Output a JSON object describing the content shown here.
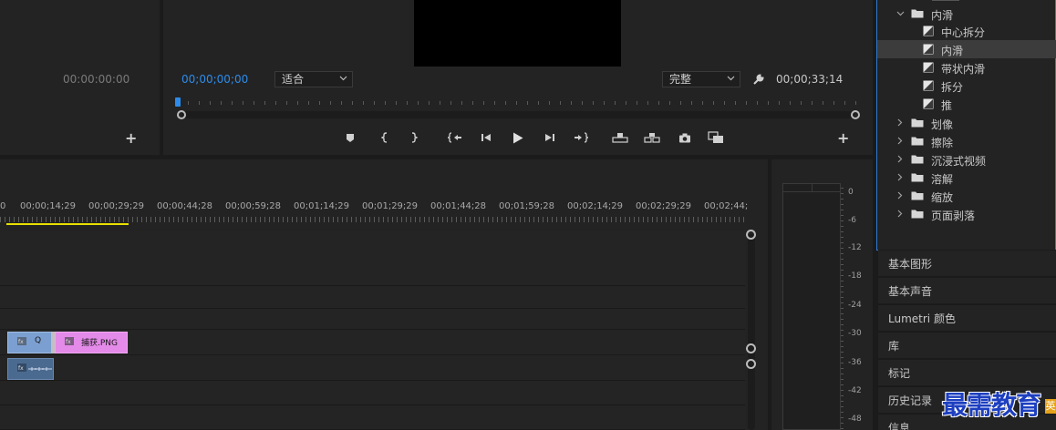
{
  "source_monitor": {
    "timecode": "00:00:00:00",
    "add_symbol": "+"
  },
  "program_monitor": {
    "timecode_current": "00;00;00;00",
    "zoom_select": "适合",
    "quality_select": "完整",
    "timecode_duration": "00;00;33;14",
    "add_symbol": "+"
  },
  "effects_tree": {
    "folder_open": "内滑",
    "items": [
      "中心拆分",
      "内滑",
      "带状内滑",
      "拆分",
      "推"
    ],
    "selected_item": "内滑",
    "folders": [
      "划像",
      "擦除",
      "沉浸式视频",
      "溶解",
      "缩放",
      "页面剥落"
    ]
  },
  "side_panels": [
    "基本图形",
    "基本声音",
    "Lumetri 颜色",
    "库",
    "标记",
    "历史记录",
    "信息"
  ],
  "timeline": {
    "ruler_labels": [
      "0",
      "00;00;14;29",
      "00;00;29;29",
      "00;00;44;28",
      "00;00;59;28",
      "00;01;14;29",
      "00;01;29;29",
      "00;01;44;28",
      "00;01;59;28",
      "00;02;14;29",
      "00;02;29;29",
      "00;02;44;"
    ],
    "clip_q_label": "Q",
    "clip_png_label": "捕获.PNG"
  },
  "audio_meter": {
    "labels": [
      "0",
      "-6",
      "-12",
      "-18",
      "-24",
      "-30",
      "-36",
      "-42",
      "-48"
    ]
  },
  "watermark": {
    "text": "最需教育",
    "tag": "英"
  },
  "colors": {
    "accent_blue": "#2d8ceb",
    "clip_blue": "#7b9fd0",
    "clip_pink": "#e48ae8",
    "playhead_yellow": "#e8e000",
    "selection_bg": "#3c3c3c",
    "watermark_blue": "#1d3fc0"
  }
}
